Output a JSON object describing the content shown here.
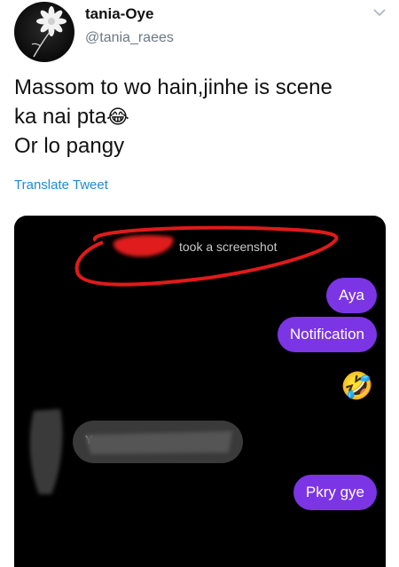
{
  "user": {
    "display_name": "tania-Oye",
    "handle": "@tania_raees"
  },
  "tweet": {
    "text": "Massom to wo hain,jinhe is scene\nka nai pta",
    "text_emoji": "😂",
    "text_line3": "Or lo pangy",
    "translate_label": "Translate Tweet"
  },
  "screenshot": {
    "notice": "took a screenshot",
    "messages_right": [
      "Aya",
      "Notification",
      "Pkry gye"
    ],
    "left_message_partial": "Y                 -",
    "reaction_emoji": "🤣",
    "emoji_row": "😂😂😂😂"
  },
  "icons": {
    "avatar": "daisy-flower-avatar",
    "menu": "chevron-down-icon"
  },
  "colors": {
    "link": "#1b8cd8",
    "bubble": "#7b35e4",
    "scribble": "#e01a1a"
  }
}
